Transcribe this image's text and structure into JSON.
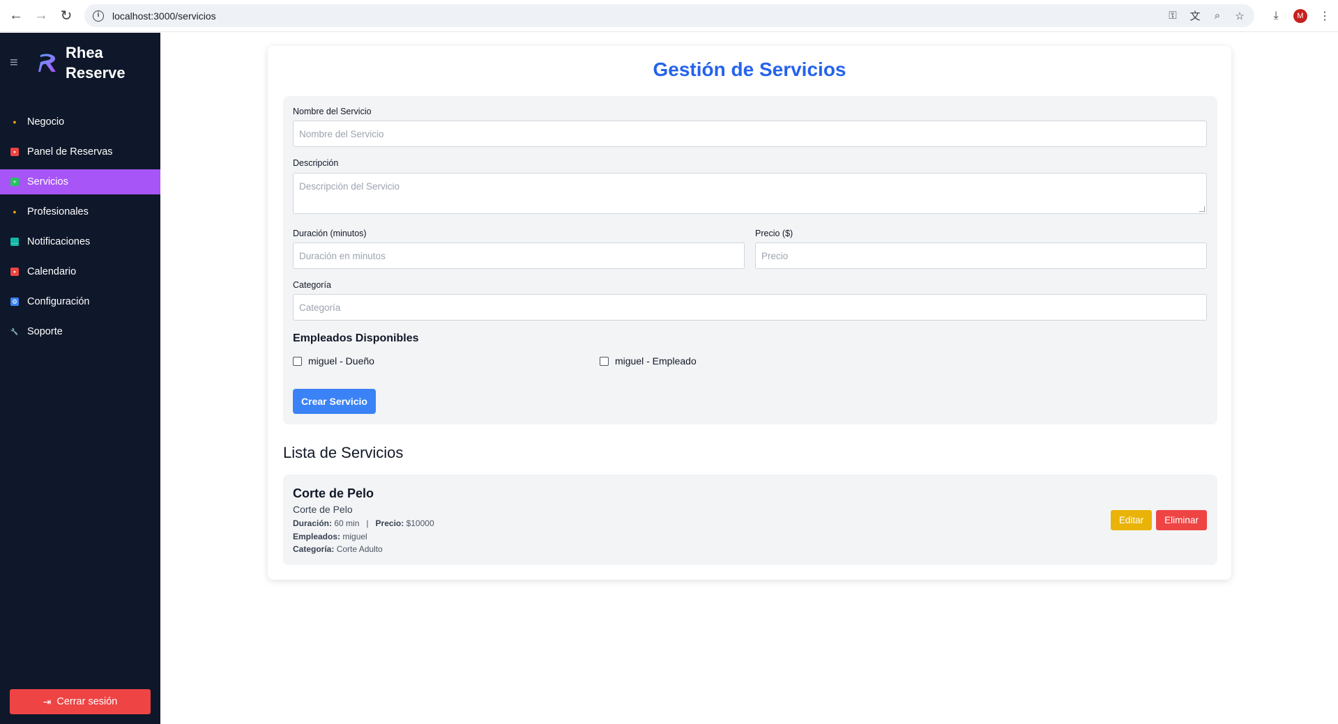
{
  "browser": {
    "url": "localhost:3000/servicios",
    "profile_initial": "M"
  },
  "sidebar": {
    "brand": "Rhea Reserve",
    "items": [
      {
        "label": "Negocio",
        "icon": "person-icon",
        "color": "#f59e0b"
      },
      {
        "label": "Panel de Reservas",
        "icon": "calendar-icon",
        "color": "#ef4444"
      },
      {
        "label": "Servicios",
        "icon": "plus-icon",
        "color": "#22c55e",
        "active": true
      },
      {
        "label": "Profesionales",
        "icon": "person-icon",
        "color": "#f59e0b"
      },
      {
        "label": "Notificaciones",
        "icon": "chat-icon",
        "color": "#14b8a6"
      },
      {
        "label": "Calendario",
        "icon": "calendar-icon",
        "color": "#ef4444"
      },
      {
        "label": "Configuración",
        "icon": "gear-icon",
        "color": "#3b82f6"
      },
      {
        "label": "Soporte",
        "icon": "wrench-icon",
        "color": "#9ca3af"
      }
    ],
    "logout_label": "Cerrar sesión"
  },
  "main": {
    "title": "Gestión de Servicios",
    "form": {
      "name_label": "Nombre del Servicio",
      "name_placeholder": "Nombre del Servicio",
      "description_label": "Descripción",
      "description_placeholder": "Descripción del Servicio",
      "duration_label": "Duración (minutos)",
      "duration_placeholder": "Duración en minutos",
      "price_label": "Precio ($)",
      "price_placeholder": "Precio",
      "category_label": "Categoría",
      "category_placeholder": "Categoría",
      "employees_title": "Empleados Disponibles",
      "employees": [
        "miguel - Dueño",
        "miguel - Empleado"
      ],
      "submit_label": "Crear Servicio"
    },
    "list_title": "Lista de Servicios",
    "services": [
      {
        "name": "Corte de Pelo",
        "description": "Corte de Pelo",
        "duration_label": "Duración:",
        "duration_value": "60 min",
        "separator": "|",
        "price_label": "Precio:",
        "price_value": "$10000",
        "employees_label": "Empleados:",
        "employees_value": "miguel",
        "category_label": "Categoría:",
        "category_value": "Corte Adulto",
        "edit_label": "Editar",
        "delete_label": "Eliminar"
      }
    ]
  }
}
